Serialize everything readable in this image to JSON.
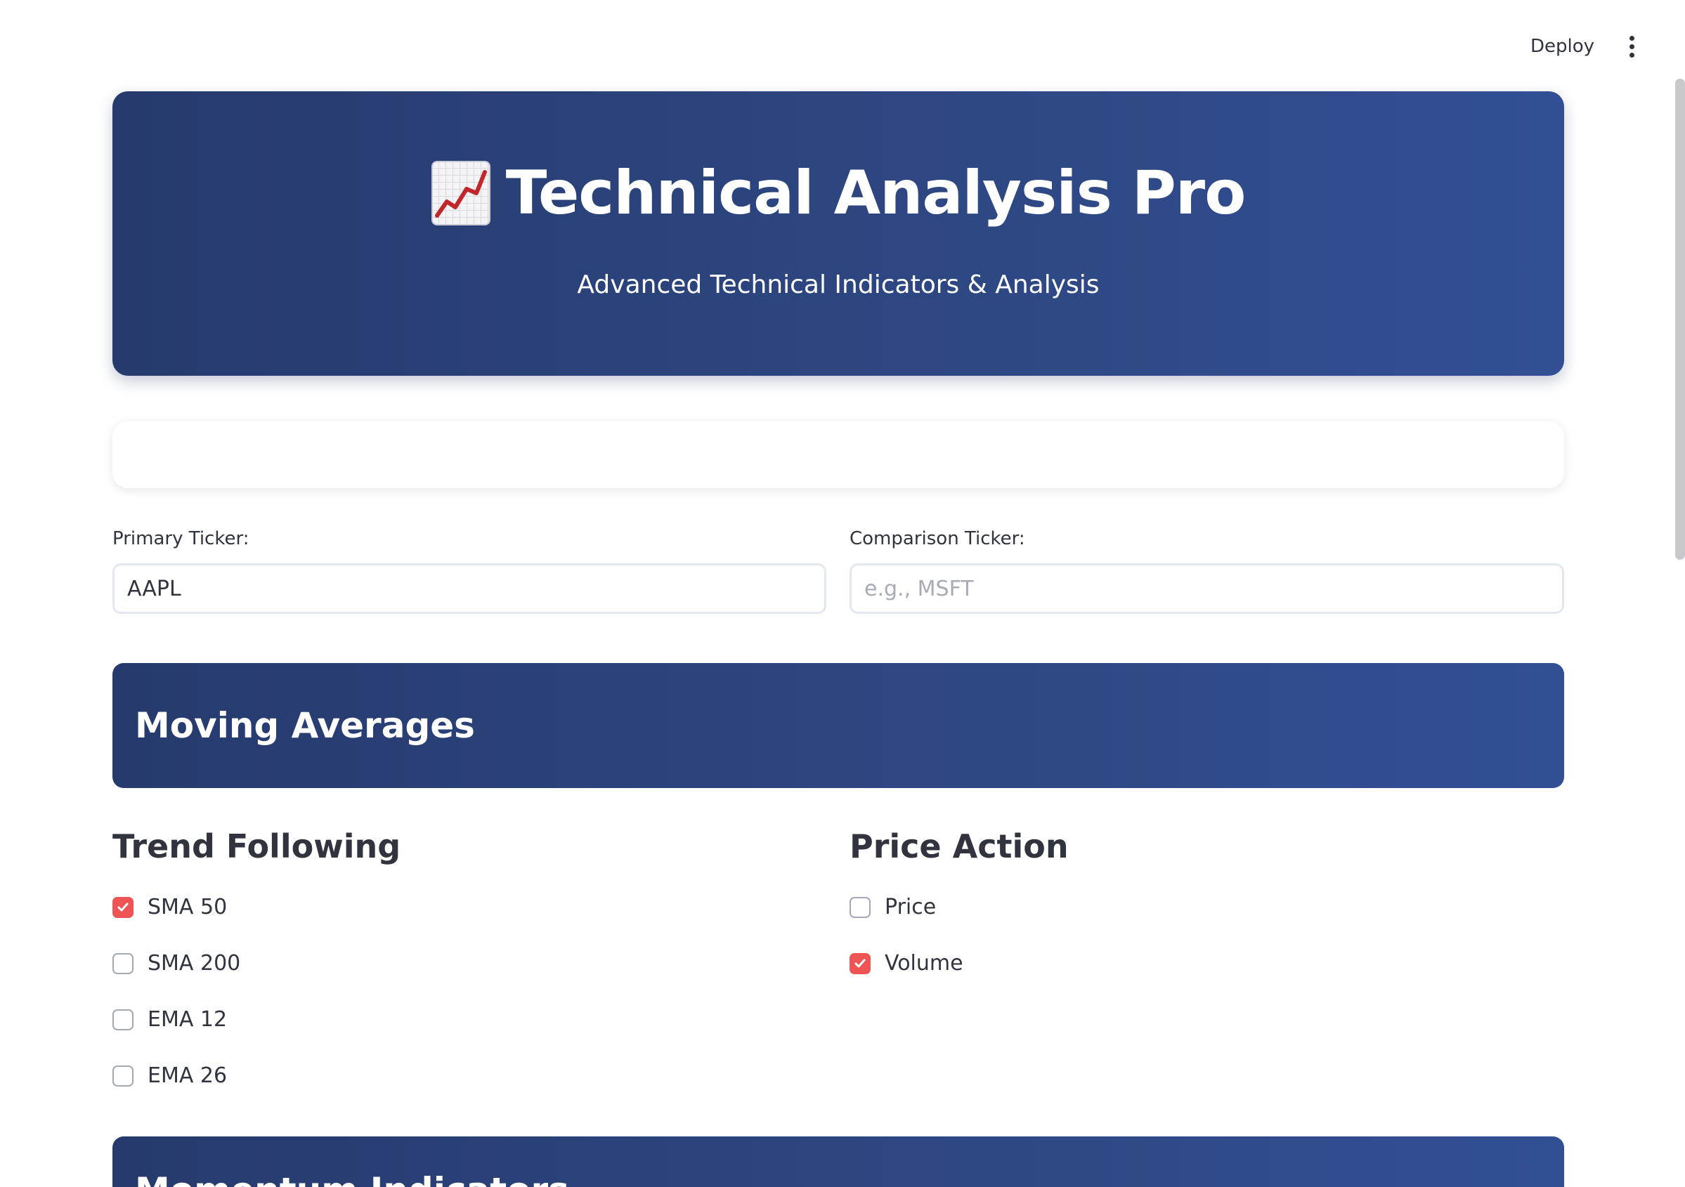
{
  "topbar": {
    "deploy_label": "Deploy",
    "menu_icon": "more-vertical-icon"
  },
  "hero": {
    "icon": "chart-increasing-icon",
    "title": "Technical Analysis Pro",
    "subtitle": "Advanced Technical Indicators & Analysis"
  },
  "inputs": {
    "primary": {
      "label": "Primary Ticker:",
      "value": "AAPL",
      "placeholder": ""
    },
    "comparison": {
      "label": "Comparison Ticker:",
      "value": "",
      "placeholder": "e.g., MSFT"
    }
  },
  "sections": {
    "moving_averages": {
      "title": "Moving Averages",
      "trend_following": {
        "heading": "Trend Following",
        "options": [
          {
            "label": "SMA 50",
            "checked": true
          },
          {
            "label": "SMA 200",
            "checked": false
          },
          {
            "label": "EMA 12",
            "checked": false
          },
          {
            "label": "EMA 26",
            "checked": false
          }
        ]
      },
      "price_action": {
        "heading": "Price Action",
        "options": [
          {
            "label": "Price",
            "checked": false
          },
          {
            "label": "Volume",
            "checked": true
          }
        ]
      }
    },
    "momentum": {
      "title": "Momentum Indicators"
    }
  },
  "colors": {
    "banner_start": "#263a6d",
    "banner_end": "#334f94",
    "checkbox_checked": "#ef5455"
  }
}
